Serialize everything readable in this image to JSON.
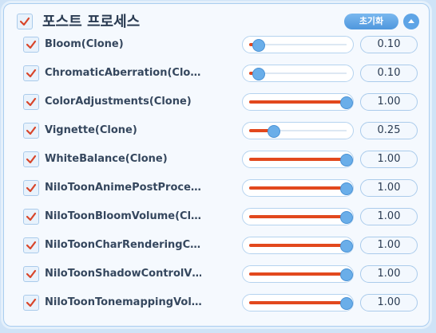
{
  "header": {
    "title": "포스트 프로세스",
    "reset_label": "초기화",
    "enabled": true
  },
  "colors": {
    "accent": "#5ea4e6",
    "fill": "#e2481d",
    "check": "#d8452a"
  },
  "effects": [
    {
      "label": "Bloom(Clone)",
      "value": "0.10",
      "level": 0.1,
      "enabled": true
    },
    {
      "label": "ChromaticAberration(Clo…",
      "value": "0.10",
      "level": 0.1,
      "enabled": true
    },
    {
      "label": "ColorAdjustments(Clone)",
      "value": "1.00",
      "level": 1.0,
      "enabled": true
    },
    {
      "label": "Vignette(Clone)",
      "value": "0.25",
      "level": 0.25,
      "enabled": true
    },
    {
      "label": "WhiteBalance(Clone)",
      "value": "1.00",
      "level": 1.0,
      "enabled": true
    },
    {
      "label": "NiloToonAnimePostProce…",
      "value": "1.00",
      "level": 1.0,
      "enabled": true
    },
    {
      "label": "NiloToonBloomVolume(Cl…",
      "value": "1.00",
      "level": 1.0,
      "enabled": true
    },
    {
      "label": "NiloToonCharRenderingC…",
      "value": "1.00",
      "level": 1.0,
      "enabled": true
    },
    {
      "label": "NiloToonShadowControlV…",
      "value": "1.00",
      "level": 1.0,
      "enabled": true
    },
    {
      "label": "NiloToonTonemappingVol…",
      "value": "1.00",
      "level": 1.0,
      "enabled": true
    }
  ]
}
